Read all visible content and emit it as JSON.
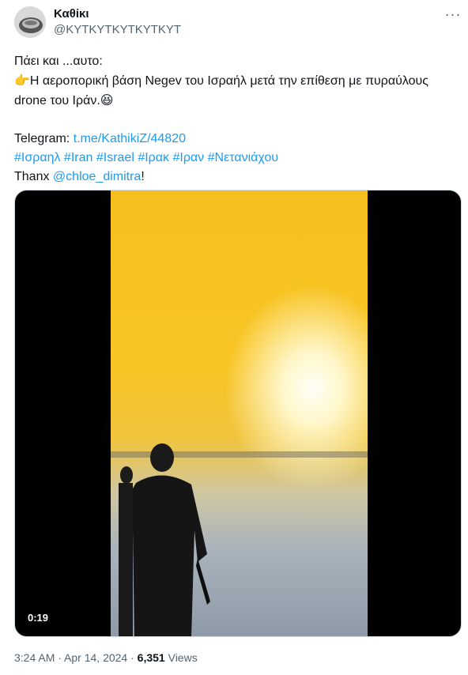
{
  "author": {
    "name": "Καθίκι",
    "handle": "@KYTKYTKYTKYTKYT"
  },
  "tweet": {
    "line1": "Πάει και ...αυτο:",
    "line2_pointer": "👉",
    "line2_text": "Η αεροπορική βάση Negev του Ισραήλ μετά την επίθεση με πυραύλους",
    "line3_text": "drone του Ιράν.",
    "line3_emoji": "😆",
    "telegram_label": "Telegram: ",
    "telegram_link": "t.me/KathikiZ/44820",
    "hashtags": [
      "#Ισραηλ",
      "#Iran",
      "#Israel",
      "#Ιρακ",
      "#Ιραν",
      "#Νετανιάχου"
    ],
    "thanks_prefix": "Thanx ",
    "thanks_mention": "@chloe_dimitra",
    "thanks_suffix": "!"
  },
  "media": {
    "duration": "0:19"
  },
  "meta": {
    "time": "3:24 AM",
    "sep1": " · ",
    "date": "Apr 14, 2024",
    "sep2": " · ",
    "views_count": "6,351",
    "views_label": " Views"
  },
  "icons": {
    "more": "more-horizontal-icon",
    "pointer": "backhand-index-pointing-right-emoji",
    "laugh": "grinning-squinting-face-emoji"
  },
  "colors": {
    "link": "#1d9bf0",
    "secondary_text": "#536471",
    "primary_text": "#0f1419",
    "border": "#cfd9de"
  }
}
